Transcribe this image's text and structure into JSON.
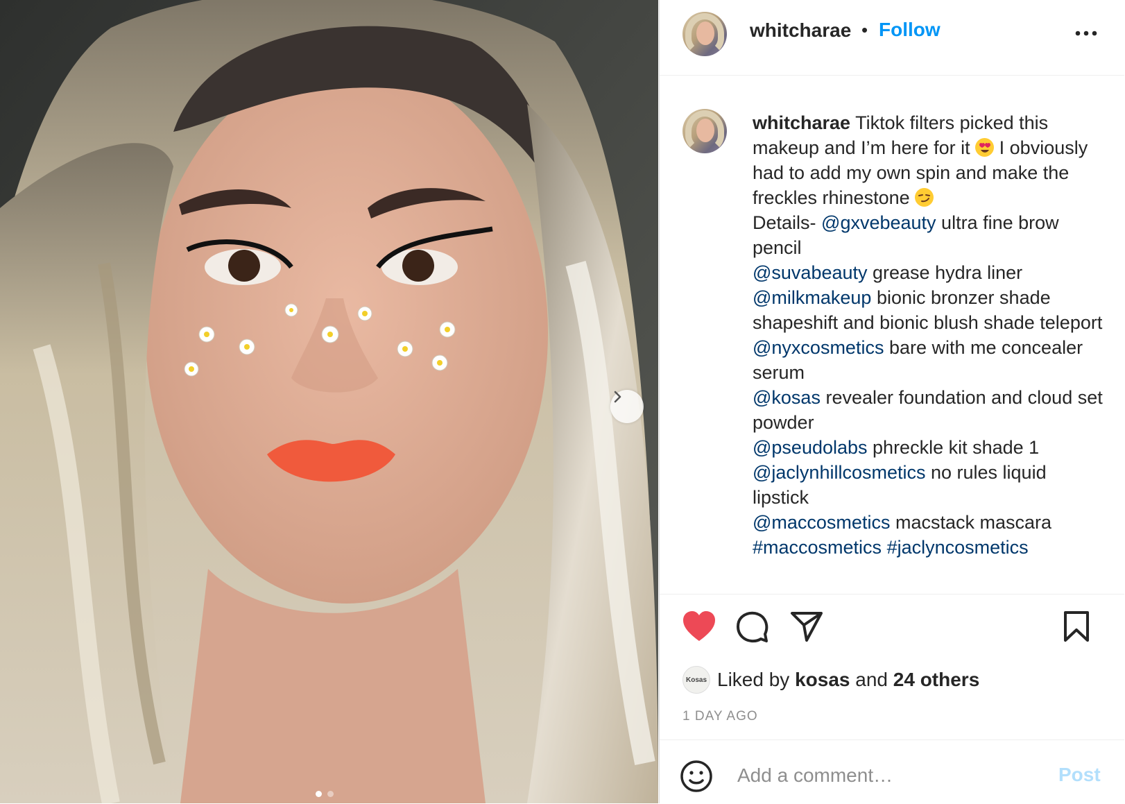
{
  "post": {
    "username": "whitcharae",
    "separator": "•",
    "follow_label": "Follow",
    "more_icon": "more-horizontal-icon"
  },
  "photo": {
    "description_icon": "selfie-photo",
    "carousel_next_icon": "chevron-right-icon",
    "carousel_dots": 2,
    "carousel_active": 0
  },
  "caption": {
    "username": "whitcharae",
    "segments": {
      "s1": " Tiktok filters picked this makeup and I’m here for it ",
      "s2": " I obviously had to add my own spin and make the freckles rhinestone ",
      "s3": " Details- ",
      "m1": "@gxvebeauty",
      "s4": " ultra fine brow pencil",
      "m2": "@suvabeauty",
      "s5": " grease hydra liner",
      "m3": "@milkmakeup",
      "s6": " bionic bronzer shade shapeshift and bionic blush shade teleport",
      "m4": "@nyxcosmetics",
      "s7": " bare with me concealer serum",
      "m5": "@kosas",
      "s8": " revealer foundation and cloud set powder",
      "m6": "@pseudolabs",
      "s9": " phreckle kit shade 1",
      "m7": "@jaclynhillcosmetics",
      "s10": " no rules liquid lipstick",
      "m8": "@maccosmetics",
      "s11": " macstack mascara",
      "h1": "#maccosmetics",
      "h2": "#jaclyncosmetics"
    }
  },
  "actions": {
    "like_icon": "heart-filled-icon",
    "comment_icon": "comment-icon",
    "share_icon": "paper-plane-icon",
    "save_icon": "bookmark-icon"
  },
  "likes": {
    "avatar_label": "Kosas",
    "prefix": "Liked by ",
    "first_liker": "kosas",
    "middle": " and ",
    "others": "24 others"
  },
  "timestamp": "1 DAY AGO",
  "comment": {
    "placeholder": "Add a comment…",
    "post_label": "Post"
  },
  "colors": {
    "accent": "#0095f6",
    "mention": "#00376b",
    "like": "#ed4956",
    "post_disabled": "#b2dffc",
    "muted": "#8e8e8e"
  }
}
